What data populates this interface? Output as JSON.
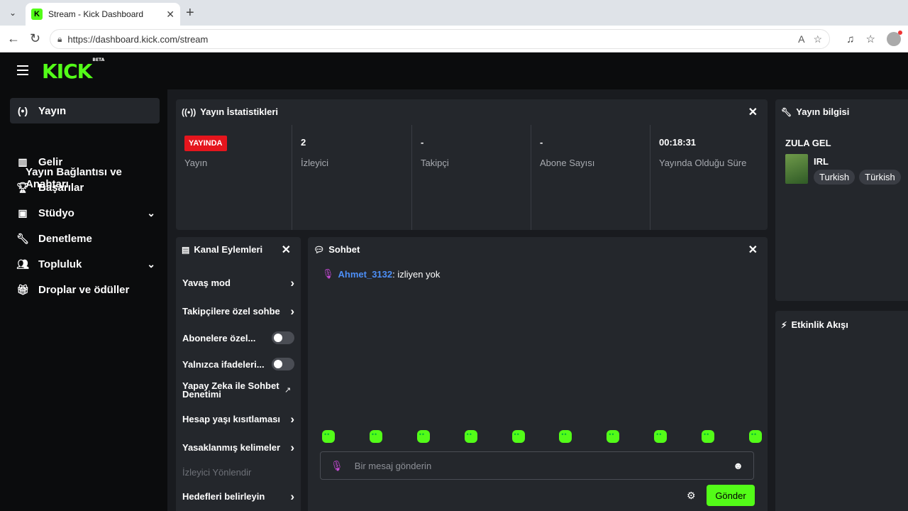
{
  "browser": {
    "tab_title": "Stream - Kick Dashboard",
    "url": "https://dashboard.kick.com/stream"
  },
  "brand": {
    "logo": "KICK",
    "badge": "BETA",
    "accent": "#53fc18"
  },
  "sidebar": {
    "items": [
      {
        "label": "Yayın",
        "icon": "broadcast-icon"
      },
      {
        "label": "Yayın Bağlantısı ve Anahtarı"
      },
      {
        "label": "Gelir",
        "icon": "chart-icon"
      },
      {
        "label": "Başarılar",
        "icon": "trophy-icon"
      },
      {
        "label": "Stüdyo",
        "icon": "studio-icon"
      },
      {
        "label": "Denetleme",
        "icon": "wrench-icon"
      },
      {
        "label": "Topluluk",
        "icon": "people-icon"
      },
      {
        "label": "Droplar ve ödüller",
        "icon": "gift-icon"
      }
    ]
  },
  "stats": {
    "title": "Yayın İstatistikleri",
    "live_badge": "YAYINDA",
    "columns": [
      {
        "value": "",
        "label": "Yayın"
      },
      {
        "value": "2",
        "label": "İzleyici"
      },
      {
        "value": "-",
        "label": "Takipçi"
      },
      {
        "value": "-",
        "label": "Abone Sayısı"
      },
      {
        "value": "00:18:31",
        "label": "Yayında Olduğu Süre"
      }
    ]
  },
  "info": {
    "title": "Yayın bilgisi",
    "stream_title": "ZULA GEL",
    "category": "IRL",
    "tags": [
      "Turkish",
      "Türkish"
    ]
  },
  "activity": {
    "title": "Etkinlik Akışı"
  },
  "actions": {
    "title": "Kanal Eylemleri",
    "rows": [
      {
        "label": "Yavaş mod",
        "control": "chevron"
      },
      {
        "label": "Takipçilere özel sohbe",
        "control": "chevron"
      },
      {
        "label": "Abonelere özel...",
        "control": "toggle"
      },
      {
        "label": "Yalnızca ifadeleri...",
        "control": "toggle"
      },
      {
        "label": "Yapay Zeka ile Sohbet Denetimi",
        "control": "external"
      },
      {
        "label": "Hesap yaşı kısıtlaması",
        "control": "chevron"
      },
      {
        "label": "Yasaklanmış kelimeler",
        "control": "chevron"
      },
      {
        "label": "İzleyici Yönlendir",
        "control": "none"
      },
      {
        "label": "Hedefleri belirleyin",
        "control": "chevron"
      }
    ]
  },
  "chat": {
    "title": "Sohbet",
    "message": {
      "user": "Ahmet_3132",
      "text": ": izliyen yok"
    },
    "input_placeholder": "Bir mesaj gönderin",
    "send_label": "Gönder"
  }
}
